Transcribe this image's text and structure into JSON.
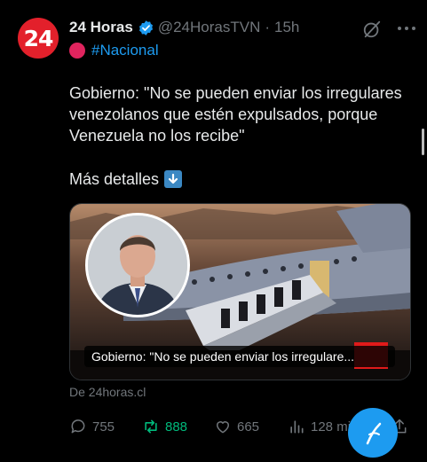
{
  "account": {
    "avatar_text": "24",
    "name": "24 Horas",
    "handle": "@24HorasTVN",
    "separator": "·",
    "time": "15h",
    "tag": "#Nacional"
  },
  "tweet": {
    "lines": [
      "Gobierno: \"No se pueden enviar los irregulares",
      "venezolanos que estén expulsados, porque",
      "Venezuela no los recibe\""
    ],
    "more": "Más detalles"
  },
  "card": {
    "caption": "Gobierno: \"No se pueden enviar los irregulare...",
    "source": "De 24horas.cl"
  },
  "actions": {
    "replies": "755",
    "reposts": "888",
    "likes": "665",
    "views": "128 mil"
  },
  "colors": {
    "accent": "#1d9bf0",
    "repost": "#00ba7c",
    "brand_red": "#e3202b"
  },
  "icons": [
    "verified-icon",
    "grok-icon",
    "more-icon",
    "red-circle-icon",
    "down-arrow-icon",
    "reply-icon",
    "repost-icon",
    "like-icon",
    "views-icon",
    "bookmark-icon",
    "share-icon"
  ]
}
